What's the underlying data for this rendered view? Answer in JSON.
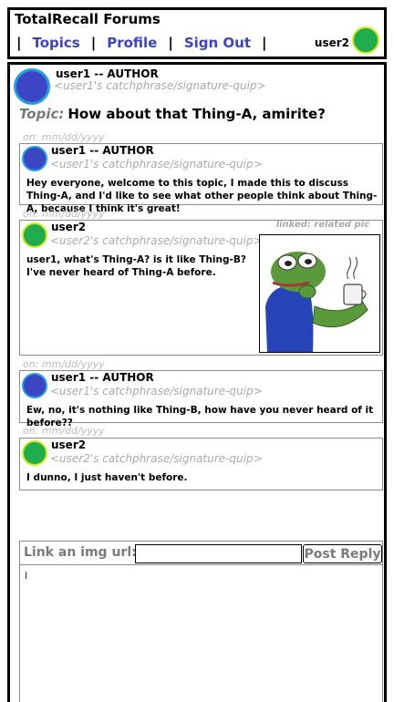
{
  "header": {
    "title": "TotalRecall Forums",
    "separator": "|",
    "nav": [
      "Topics",
      "Profile",
      "Sign Out"
    ],
    "username": "user2"
  },
  "topic": {
    "author_name": "user1 -- AUTHOR",
    "author_quip": "<user1's catchphrase/signature-quip>",
    "label": "Topic:",
    "title": "How about that Thing-A, amirite?"
  },
  "posts": [
    {
      "date": "on: mm/dd/yyyy",
      "name": "user1 -- AUTHOR",
      "quip": "<user1's catchphrase/signature-quip>",
      "body": "Hey everyone, welcome to this topic, I made this to discuss Thing-A, and I'd like to see what other people think about Thing-A, because I think it's great!"
    },
    {
      "date": "on: mm/dd/yyyy",
      "name": "user2",
      "quip": "<user2's catchphrase/signature-quip>",
      "body": "user1, what's Thing-A? is it like Thing-B? I've never heard of Thing-A before.",
      "linked_label": "linked: related pic"
    },
    {
      "date": "on: mm/dd/yyyy",
      "name": "user1 -- AUTHOR",
      "quip": "<user1's catchphrase/signature-quip>",
      "body": "Ew, no, it's nothing like Thing-B, how have you never heard of it before??"
    },
    {
      "date": "on: mm/dd/yyyy",
      "name": "user2",
      "quip": "<user2's catchphrase/signature-quip>",
      "body": "I dunno, I just haven't before."
    }
  ],
  "reply": {
    "img_label": "Link an img url:",
    "img_value": "",
    "post_label": "Post Reply",
    "text_value": ""
  },
  "colors": {
    "nav_link": "#3b44c2",
    "user1_avatar": "#3c45c4",
    "user1_ring": "#1fa0e3",
    "user2_avatar": "#1fad4e",
    "user2_ring": "#d6e81b",
    "muted_text": "#aaaaaa"
  }
}
